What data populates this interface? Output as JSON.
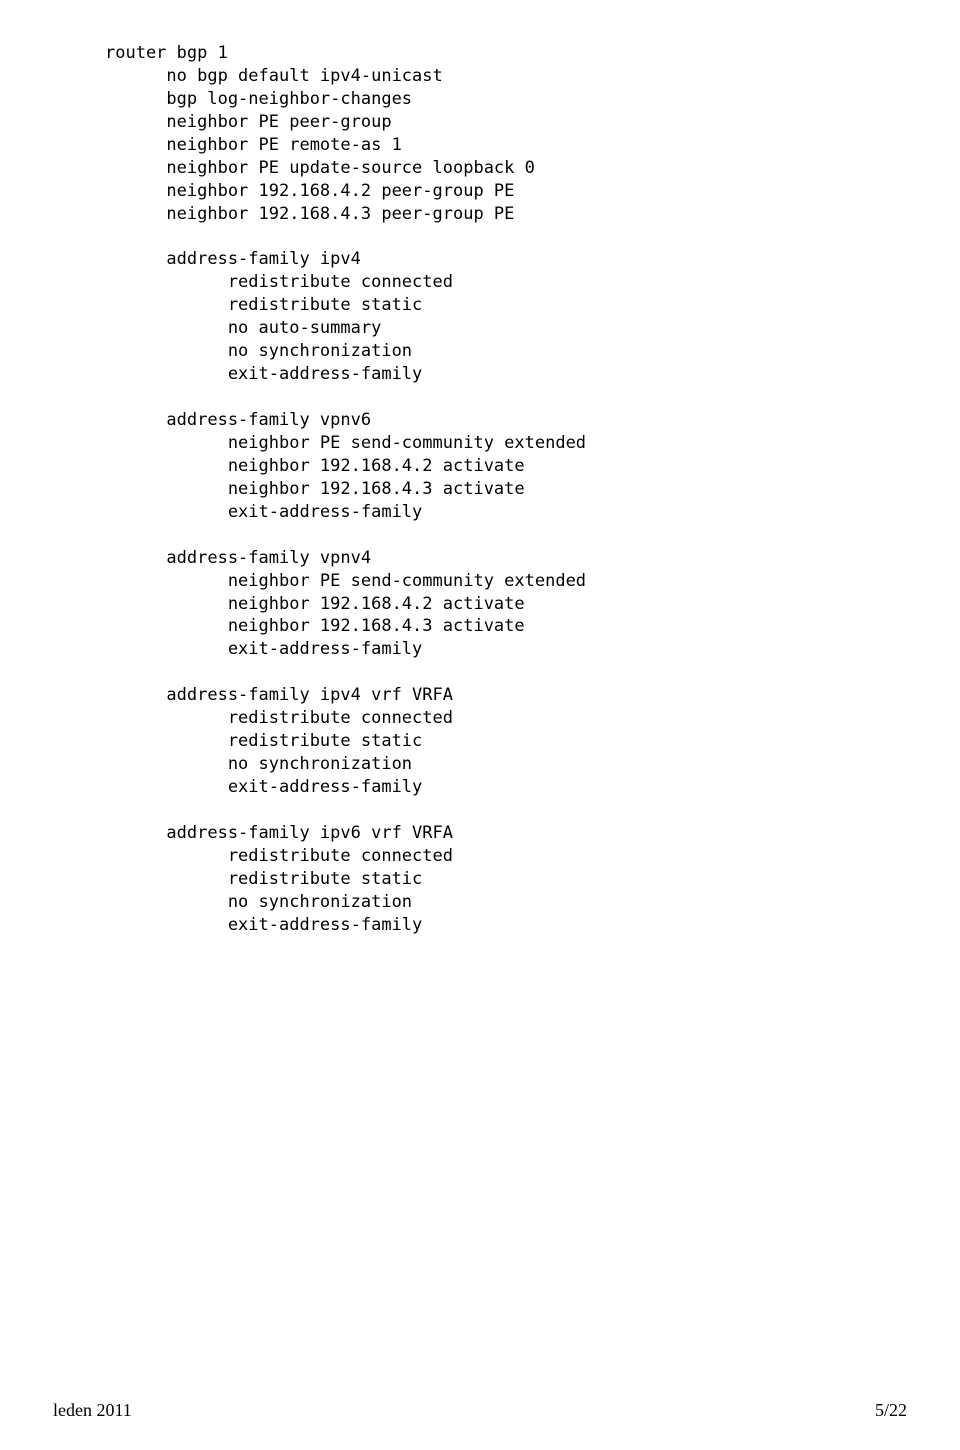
{
  "config": {
    "lines": [
      {
        "indent": 0,
        "text": "router bgp 1"
      },
      {
        "indent": 1,
        "text": "no bgp default ipv4-unicast"
      },
      {
        "indent": 1,
        "text": "bgp log-neighbor-changes"
      },
      {
        "indent": 1,
        "text": "neighbor PE peer-group"
      },
      {
        "indent": 1,
        "text": "neighbor PE remote-as 1"
      },
      {
        "indent": 1,
        "text": "neighbor PE update-source loopback 0"
      },
      {
        "indent": 1,
        "text": "neighbor 192.168.4.2 peer-group PE"
      },
      {
        "indent": 1,
        "text": "neighbor 192.168.4.3 peer-group PE"
      },
      {
        "indent": 0,
        "text": ""
      },
      {
        "indent": 1,
        "text": "address-family ipv4"
      },
      {
        "indent": 2,
        "text": "redistribute connected"
      },
      {
        "indent": 2,
        "text": "redistribute static"
      },
      {
        "indent": 2,
        "text": "no auto-summary"
      },
      {
        "indent": 2,
        "text": "no synchronization"
      },
      {
        "indent": 2,
        "text": "exit-address-family"
      },
      {
        "indent": 0,
        "text": ""
      },
      {
        "indent": 1,
        "text": "address-family vpnv6"
      },
      {
        "indent": 2,
        "text": "neighbor PE send-community extended"
      },
      {
        "indent": 2,
        "text": "neighbor 192.168.4.2 activate"
      },
      {
        "indent": 2,
        "text": "neighbor 192.168.4.3 activate"
      },
      {
        "indent": 2,
        "text": "exit-address-family"
      },
      {
        "indent": 0,
        "text": ""
      },
      {
        "indent": 1,
        "text": "address-family vpnv4"
      },
      {
        "indent": 2,
        "text": "neighbor PE send-community extended"
      },
      {
        "indent": 2,
        "text": "neighbor 192.168.4.2 activate"
      },
      {
        "indent": 2,
        "text": "neighbor 192.168.4.3 activate"
      },
      {
        "indent": 2,
        "text": "exit-address-family"
      },
      {
        "indent": 0,
        "text": ""
      },
      {
        "indent": 1,
        "text": "address-family ipv4 vrf VRFA"
      },
      {
        "indent": 2,
        "text": "redistribute connected"
      },
      {
        "indent": 2,
        "text": "redistribute static"
      },
      {
        "indent": 2,
        "text": "no synchronization"
      },
      {
        "indent": 2,
        "text": "exit-address-family"
      },
      {
        "indent": 0,
        "text": ""
      },
      {
        "indent": 1,
        "text": "address-family ipv6 vrf VRFA"
      },
      {
        "indent": 2,
        "text": "redistribute connected"
      },
      {
        "indent": 2,
        "text": "redistribute static"
      },
      {
        "indent": 2,
        "text": "no synchronization"
      },
      {
        "indent": 2,
        "text": "exit-address-family"
      }
    ],
    "indent_unit": "      "
  },
  "footer": {
    "left": "leden 2011",
    "right": "5/22"
  }
}
